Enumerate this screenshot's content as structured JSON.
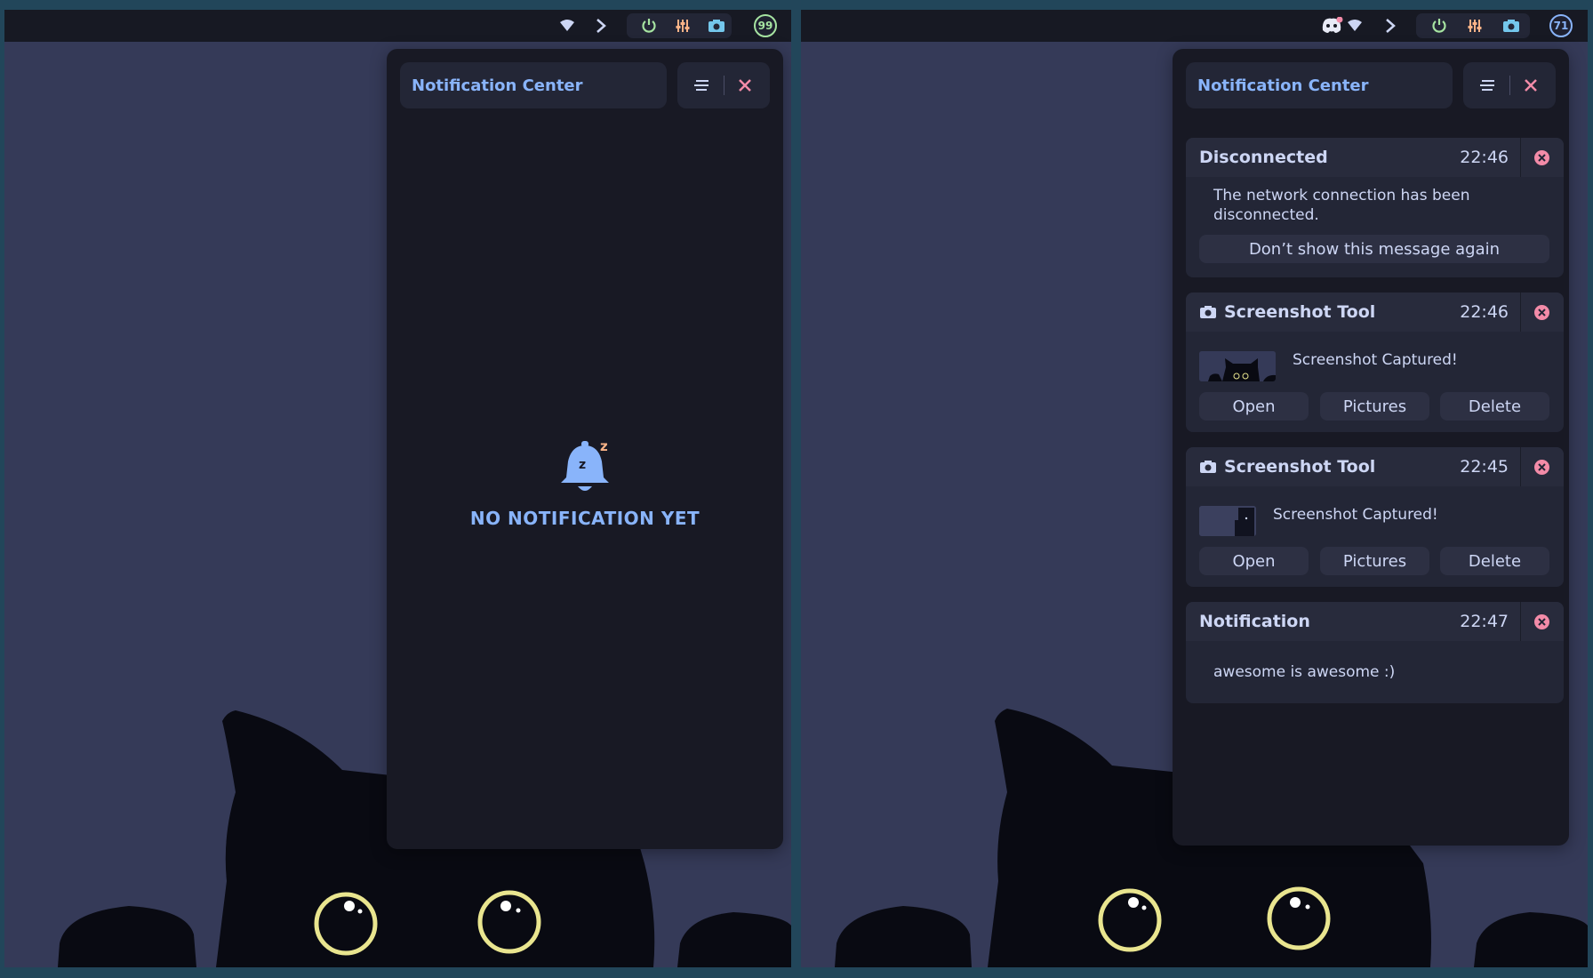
{
  "left": {
    "panel": {
      "title": "Notification Center",
      "empty_message": "NO NOTIFICATION YET"
    },
    "topbar": {
      "avatar_text": "99"
    }
  },
  "right": {
    "panel": {
      "title": "Notification Center"
    },
    "topbar": {
      "avatar_text": "71"
    },
    "notifications": [
      {
        "title": "Disconnected",
        "time": "22:46",
        "message": "The network connection has been disconnected.",
        "actions": [
          "Don’t show this message again"
        ]
      },
      {
        "title": "Screenshot Tool",
        "time": "22:46",
        "message": "Screenshot Captured!",
        "actions": [
          "Open",
          "Pictures",
          "Delete"
        ]
      },
      {
        "title": "Screenshot Tool",
        "time": "22:45",
        "message": "Screenshot Captured!",
        "actions": [
          "Open",
          "Pictures",
          "Delete"
        ]
      },
      {
        "title": "Notification",
        "time": "22:47",
        "message": "awesome is awesome :)"
      }
    ]
  },
  "icons": {
    "topbar": [
      "wifi-icon",
      "chevron-right-icon",
      "power-icon",
      "equalizer-icon",
      "camera-icon",
      "avatar"
    ],
    "right_extra": [
      "discord-icon"
    ],
    "panel": [
      "clear-all-icon",
      "close-icon",
      "bell-sleep-icon"
    ]
  },
  "colors": {
    "accent": "#89b4fa",
    "danger": "#f38ba8",
    "green": "#a6e3a1",
    "orange": "#fab387",
    "teal": "#74c7ec",
    "panel_bg": "#181924",
    "card_bg": "#232636",
    "wallpaper": "#353a58"
  }
}
